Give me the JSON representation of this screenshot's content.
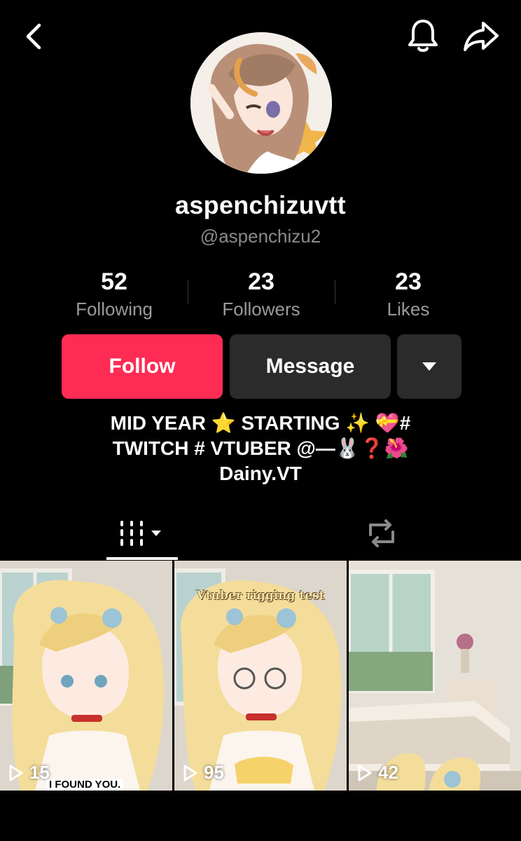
{
  "header": {
    "back_icon": "chevron-left-icon",
    "bell_icon": "bell-icon",
    "share_icon": "share-arrow-icon"
  },
  "profile": {
    "display_name": "aspenchizuvtt",
    "handle": "@aspenchizu2"
  },
  "stats": [
    {
      "value": "52",
      "label": "Following"
    },
    {
      "value": "23",
      "label": "Followers"
    },
    {
      "value": "23",
      "label": "Likes"
    }
  ],
  "actions": {
    "follow": "Follow",
    "message": "Message",
    "more_icon": "caret-down-icon"
  },
  "bio": {
    "line1": "MID YEAR ⭐ STARTING ✨ 💝#",
    "line2": "TWITCH # VTUBER @—🐰❓🌺",
    "line3": "Dainy.VT"
  },
  "tabs": {
    "videos_icon": "grid-bars-icon",
    "reposts_icon": "repost-icon"
  },
  "videos": [
    {
      "plays": "15",
      "caption": "I FOUND YOU."
    },
    {
      "plays": "95",
      "caption": "Vtuber rigging test"
    },
    {
      "plays": "42",
      "caption": ""
    }
  ],
  "colors": {
    "accent": "#fe2c55",
    "button_dark": "#2b2b2b",
    "muted": "#8a8a8a"
  }
}
